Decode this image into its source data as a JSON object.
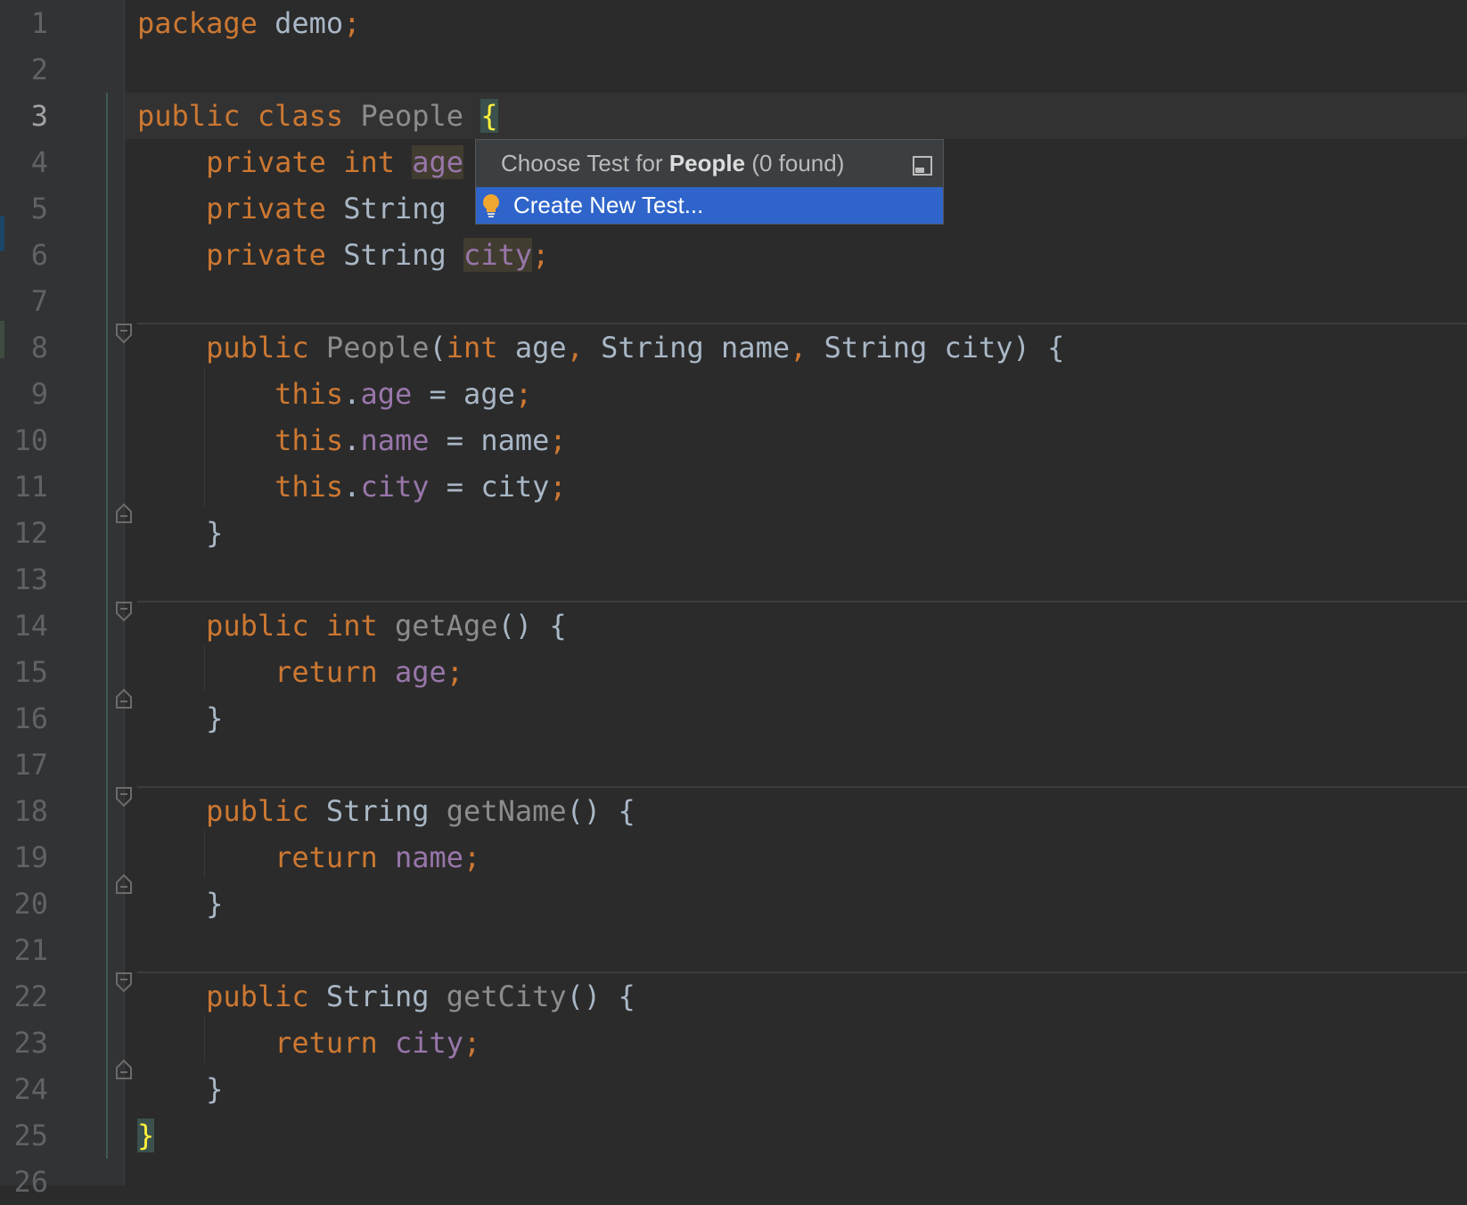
{
  "editor": {
    "line_numbers": [
      "1",
      "2",
      "3",
      "4",
      "5",
      "6",
      "7",
      "8",
      "9",
      "10",
      "11",
      "12",
      "13",
      "14",
      "15",
      "16",
      "17",
      "18",
      "19",
      "20",
      "21",
      "22",
      "23",
      "24",
      "25",
      "26"
    ],
    "current_line": "3"
  },
  "code": {
    "l1": [
      "package",
      " demo",
      ";"
    ],
    "l3": [
      "public class",
      " People ",
      "{"
    ],
    "l4": [
      "    private int ",
      "age"
    ],
    "l5": [
      "    private ",
      "String "
    ],
    "l6": [
      "    private ",
      "String ",
      "city",
      ";"
    ],
    "l8": [
      "    public ",
      "People",
      "(",
      "int",
      " age",
      ",",
      " String name",
      ",",
      " String city) {"
    ],
    "l9": [
      "        this",
      ".",
      "age",
      " = age",
      ";"
    ],
    "l10": [
      "        this",
      ".",
      "name",
      " = name",
      ";"
    ],
    "l11": [
      "        this",
      ".",
      "city",
      " = city",
      ";"
    ],
    "l12": [
      "    }"
    ],
    "l14": [
      "    public int ",
      "getAge",
      "() {"
    ],
    "l15": [
      "        return ",
      "age",
      ";"
    ],
    "l16": [
      "    }"
    ],
    "l18": [
      "    public ",
      "String ",
      "getName",
      "() {"
    ],
    "l19": [
      "        return ",
      "name",
      ";"
    ],
    "l20": [
      "    }"
    ],
    "l22": [
      "    public ",
      "String ",
      "getCity",
      "() {"
    ],
    "l23": [
      "        return ",
      "city",
      ";"
    ],
    "l24": [
      "    }"
    ],
    "l25": [
      "}"
    ]
  },
  "popup": {
    "title_prefix": "Choose Test for ",
    "title_bold": "People",
    "title_suffix": " (0 found)",
    "pin_icon": "pin-icon",
    "item_icon": "bulb-icon",
    "item_label": "Create New Test...",
    "colors": {
      "selection": "#2f65ca",
      "bulb": "#f0a732"
    }
  }
}
